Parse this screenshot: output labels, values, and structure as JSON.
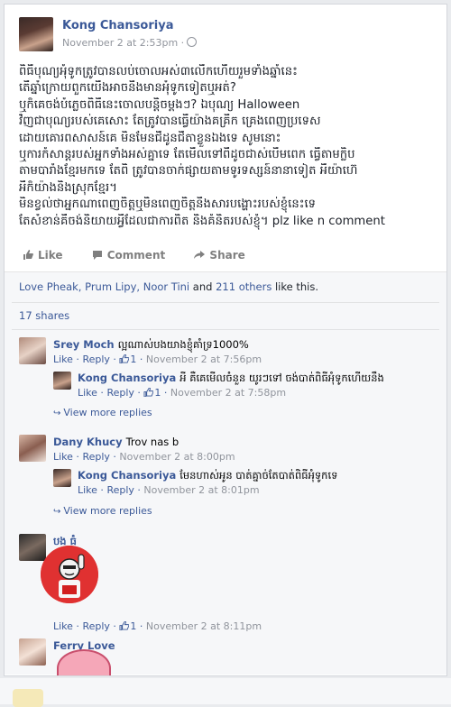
{
  "post": {
    "author": "Kong Chansoriya",
    "time": "November 2 at 2:53pm ·",
    "lines": [
      "ពិធីបុណ្យអុំទូកត្រូវបានលប់ចោលអស់៣លើកហើយរួមទាំងឆ្នាំនេះ",
      "តើឆ្នាំក្រោយពួកយើងអាចនឹងមានអុំទូកទៀតឬអត់?",
      "ឬក៏គេចង់បំភ្លេចពិធីនេះចោលបន្តិចម្តងៗ? ឯបុណ្យ Halloween",
      "វិញជាបុណ្យរបស់គេសោះ តែត្រូវបានធ្វើយ៉ាងគគ្រឹក គ្រេងពេញប្រទេស",
      "ដោយគោរពសាសន៍គេ មិនមែនជីដូនជីតាខ្លួនឯងទេ សូមនោះ",
      "ឬការកំសាន្តរបស់អ្នកទាំងអស់គ្នាទេ តែមើលទៅពីដូចជាស់បើមពេក ធ្វើតាមក្លិប",
      "តាមបារាំងខ្មែរមកទេ តែពិ ត្រូវបានចាក់ផ្សាយតាមទូរទស្សន៍នានាទៀត អីយ៉ាហ៊េ",
      "អីក៏យ៉ាងនិងស្រុកខ្មែរ។",
      "មិនខ្វល់ថាអ្នកណាពេញចិត្តឬមិនពេញចិត្តនឹងសារបង្ហោះរបស់ខ្ញុំនេះទេ",
      "តែសំខាន់គឺចង់និយាយអ្វីដែលជាការពិត និងគំនិតរបស់ខ្ញុំ។ plz like n comment"
    ]
  },
  "actions": {
    "like": "Like",
    "comment": "Comment",
    "share": "Share"
  },
  "likes": {
    "names": "Love Pheak, Prum Lipy, Noor Tini",
    "and": "and",
    "others": "211 others",
    "suffix": "like this."
  },
  "shares": "17 shares",
  "comments": [
    {
      "author": "Srey Moch",
      "text": "ល្អណាស់បងយាងខ្ញុំគាំទ្រ1000%",
      "like": "Like",
      "reply": "Reply",
      "likes": "1",
      "time": "November 2 at 7:56pm",
      "reply_item": {
        "author": "Kong Chansoriya",
        "text": "អី គឺគេមើលចំនួន យូរៗទៅ ចង់បាត់ពិធីអុំទូកហើយនឹង",
        "like": "Like",
        "reply": "Reply",
        "likes": "1",
        "time": "November 2 at 7:58pm"
      },
      "more": "View more replies"
    },
    {
      "author": "Dany Khucy",
      "text": "Trov nas b",
      "like": "Like",
      "reply": "Reply",
      "time": "November 2 at 8:00pm",
      "reply_item": {
        "author": "Kong Chansoriya",
        "text": "មែនហាស់អូន បាត់គ្នាច់តែបាត់ពិធីអុំទូកទេ",
        "like": "Like",
        "reply": "Reply",
        "time": "November 2 at 8:01pm"
      },
      "more": "View more replies"
    },
    {
      "author": "បង ធំ",
      "like": "Like",
      "reply": "Reply",
      "likes": "1",
      "time": "November 2 at 8:11pm"
    },
    {
      "author": "Ferry Love"
    }
  ],
  "colors": {
    "link": "#3b5998",
    "meta": "#90949c",
    "background": "#e9ebee"
  }
}
